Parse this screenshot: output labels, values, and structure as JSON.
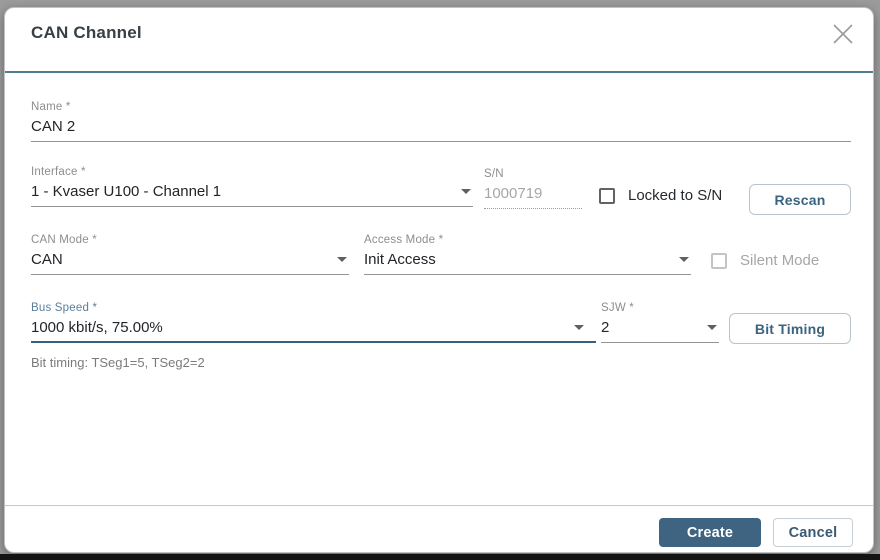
{
  "dialog": {
    "title": "CAN Channel"
  },
  "form": {
    "name": {
      "label": "Name *",
      "value": "CAN 2"
    },
    "interface": {
      "label": "Interface *",
      "value": "1 - Kvaser U100 - Channel 1"
    },
    "serial": {
      "label": "S/N",
      "value": "1000719",
      "disabled": true
    },
    "locked_to_sn": {
      "label": "Locked to S/N",
      "checked": false
    },
    "rescan": {
      "label": "Rescan"
    },
    "can_mode": {
      "label": "CAN Mode *",
      "value": "CAN"
    },
    "access_mode": {
      "label": "Access Mode *",
      "value": "Init Access"
    },
    "silent_mode": {
      "label": "Silent Mode",
      "checked": false,
      "disabled": true
    },
    "bus_speed": {
      "label": "Bus Speed *",
      "value": "1000 kbit/s, 75.00%",
      "focused": true
    },
    "sjw": {
      "label": "SJW *",
      "value": "2"
    },
    "bit_timing": {
      "label": "Bit Timing"
    },
    "bit_timing_hint": "Bit timing: TSeg1=5, TSeg2=2"
  },
  "footer": {
    "create": "Create",
    "cancel": "Cancel"
  },
  "colors": {
    "accent": "#3e6482",
    "focused_label": "#5b7f9a",
    "focused_underline": "#3a607e",
    "header_divider": "#4f7d92",
    "footer_divider": "#b9ccd5",
    "outline_button_text": "#3a6480"
  }
}
